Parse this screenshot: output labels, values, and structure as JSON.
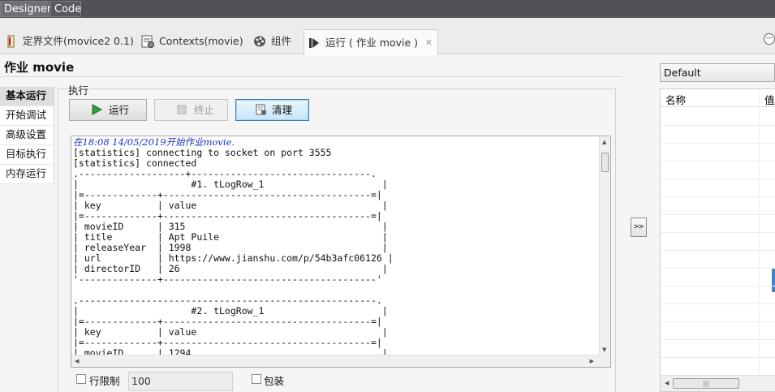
{
  "mode_tabs": [
    "Designer",
    "Code"
  ],
  "editor_tabs": [
    {
      "label": "定界文件(movice2 0.1)",
      "icon": "job-design-icon"
    },
    {
      "label": "Contexts(movie)",
      "icon": "contexts-icon"
    },
    {
      "label": "组件",
      "icon": "palette-icon"
    },
    {
      "label": "运行 ( 作业 movie )",
      "icon": "run-view-icon"
    }
  ],
  "job_title": "作业 movie",
  "left_nav": [
    "基本运行",
    "开始调试",
    "高级设置",
    "目标执行",
    "内存运行"
  ],
  "group_label": "执行",
  "buttons": {
    "run": "运行",
    "stop": "终止",
    "clear": "清理"
  },
  "console": {
    "start_line": "在18:08 14/05/2019开始作业movie.",
    "lines": [
      "[statistics] connecting to socket on port 3555",
      "[statistics] connected",
      ".-------------------+--------------------------------.",
      "|                    #1. tLogRow_1                     |",
      "|=-------------+-------------------------------------=|",
      "| key          | value                                 |",
      "|=-------------+-------------------------------------=|",
      "| movieID      | 315                                   |",
      "| title        | Apt Puile                             |",
      "| releaseYear  | 1998                                  |",
      "| url          | https://www.jianshu.com/p/54b3afc06126 |",
      "| directorID   | 26                                    |",
      "'--------------+--------------------------------------'",
      "",
      ".-----------------------------------------------------.",
      "|                    #2. tLogRow_1                     |",
      "|=-------------+-------------------------------------=|",
      "| key          | value                                 |",
      "|=-------------+-------------------------------------=|",
      "| movieID      | 1294                                  |"
    ]
  },
  "options": {
    "limit_label": "行限制",
    "limit_value": "100",
    "wrap_label": "包装"
  },
  "expand_button": ">>",
  "context": {
    "selected": "Default",
    "col_name": "名称",
    "col_value": "值"
  }
}
